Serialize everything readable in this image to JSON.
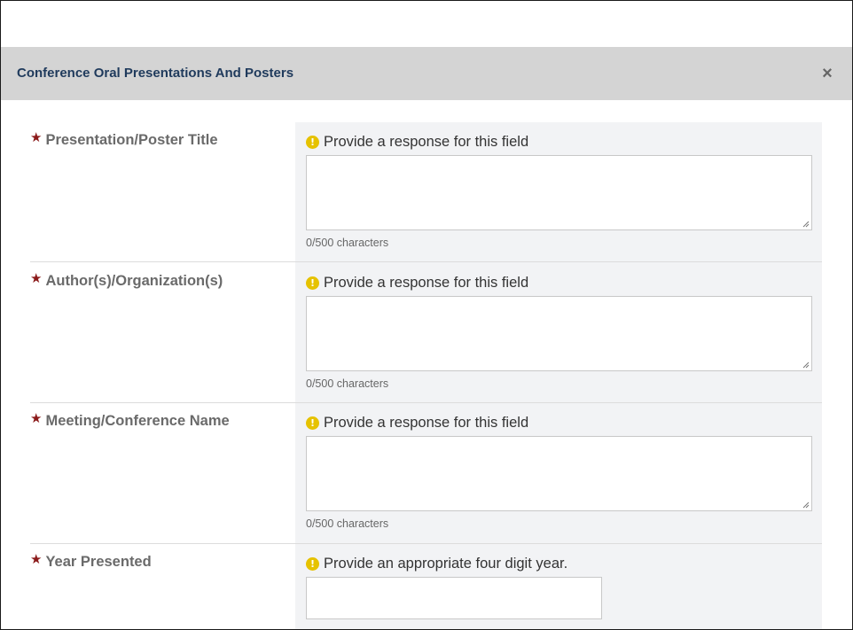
{
  "modal": {
    "title": "Conference Oral Presentations And Posters",
    "close_label": "×"
  },
  "fields": [
    {
      "label": "Presentation/Poster Title",
      "required_marker": "★",
      "hint": "Provide a response for this field",
      "value": "",
      "counter": "0/500 characters"
    },
    {
      "label": "Author(s)/Organization(s)",
      "required_marker": "★",
      "hint": "Provide a response for this field",
      "value": "",
      "counter": "0/500 characters"
    },
    {
      "label": "Meeting/Conference Name",
      "required_marker": "★",
      "hint": "Provide a response for this field",
      "value": "",
      "counter": "0/500 characters"
    },
    {
      "label": "Year Presented",
      "required_marker": "★",
      "hint": "Provide an appropriate four digit year.",
      "value": ""
    }
  ],
  "icons": {
    "warning": "!",
    "warning_color": "#e6c200",
    "required_color": "#8b1a1a"
  },
  "colors": {
    "header_bg": "#d4d4d4",
    "title_color": "#1f3a5c",
    "input_column_bg": "#f2f3f5"
  }
}
